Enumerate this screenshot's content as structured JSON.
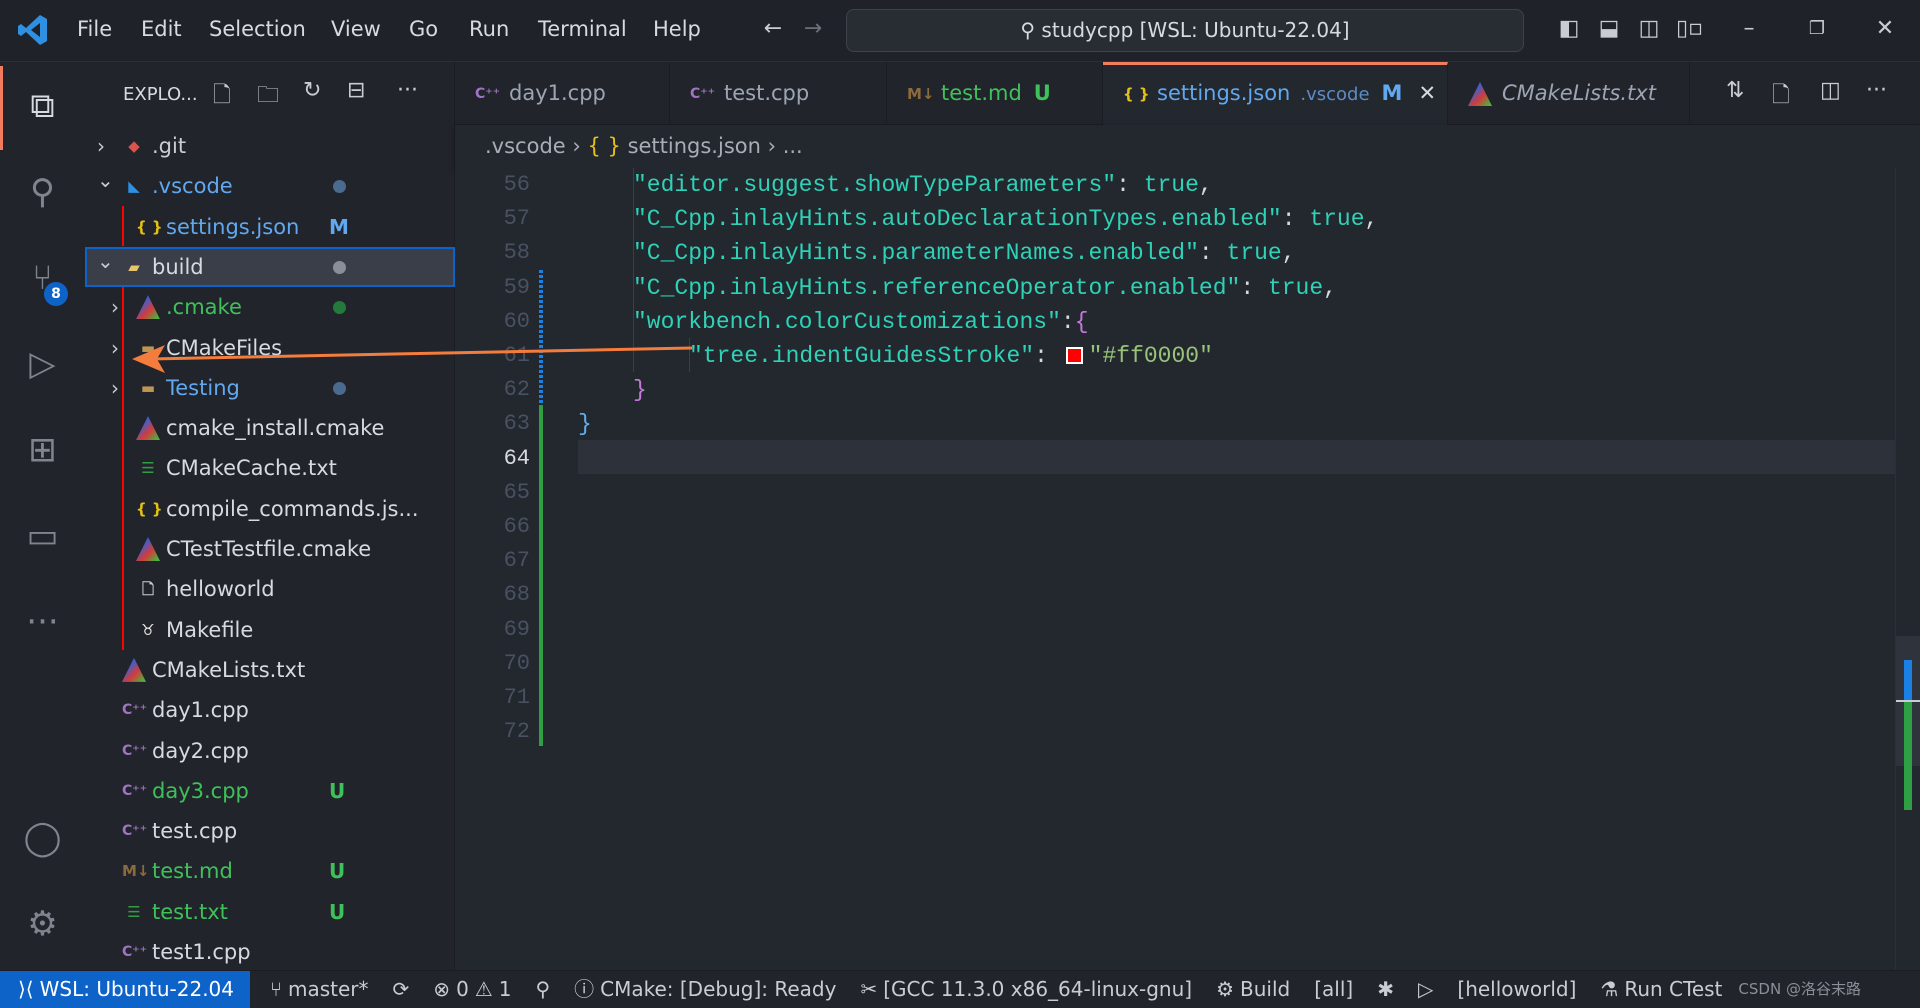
{
  "titlebar": {
    "menu": [
      "File",
      "Edit",
      "Selection",
      "View",
      "Go",
      "Run",
      "Terminal",
      "Help"
    ],
    "search": "studycpp [WSL: Ubuntu-22.04]"
  },
  "activity_bar": {
    "items": [
      {
        "icon": "explorer-icon",
        "active": true
      },
      {
        "icon": "search-icon"
      },
      {
        "icon": "source-control-icon",
        "badge": "8"
      },
      {
        "icon": "run-debug-icon"
      },
      {
        "icon": "extensions-icon"
      },
      {
        "icon": "remote-explorer-icon"
      },
      {
        "icon": "more-icon"
      }
    ],
    "bottom": [
      {
        "icon": "account-icon"
      },
      {
        "icon": "settings-gear-icon"
      }
    ]
  },
  "sidebar": {
    "title": "EXPLO...",
    "tree": [
      {
        "name": ".git",
        "depth": 0,
        "chevron": "closed",
        "icon": "git-folder",
        "color": "#c9ccd2"
      },
      {
        "name": ".vscode",
        "depth": 0,
        "chevron": "open",
        "icon": "vscode-folder",
        "color": "#61a8f0",
        "dot": "#4b6a8f"
      },
      {
        "name": "settings.json",
        "depth": 1,
        "icon": "json",
        "color": "#61a8f0",
        "badge": "M",
        "badge_color": "#61a8f0"
      },
      {
        "name": "build",
        "depth": 0,
        "chevron": "open",
        "icon": "build-folder",
        "color": "#d7dae0",
        "dot": "#8a8e96",
        "selected": true
      },
      {
        "name": ".cmake",
        "depth": 1,
        "chevron": "closed",
        "icon": "cmake-folder",
        "color": "#3fc15a",
        "dot": "#237a3a"
      },
      {
        "name": "CMakeFiles",
        "depth": 1,
        "chevron": "closed",
        "icon": "folder",
        "color": "#d7dae0"
      },
      {
        "name": "Testing",
        "depth": 1,
        "chevron": "closed",
        "icon": "folder",
        "color": "#61a8f0",
        "dot": "#4b6a8f"
      },
      {
        "name": "cmake_install.cmake",
        "depth": 1,
        "icon": "cmake",
        "color": "#d7dae0"
      },
      {
        "name": "CMakeCache.txt",
        "depth": 1,
        "icon": "text",
        "color": "#d7dae0"
      },
      {
        "name": "compile_commands.js...",
        "depth": 1,
        "icon": "json",
        "color": "#d7dae0"
      },
      {
        "name": "CTestTestfile.cmake",
        "depth": 1,
        "icon": "cmake",
        "color": "#d7dae0"
      },
      {
        "name": "helloworld",
        "depth": 1,
        "icon": "file",
        "color": "#d7dae0"
      },
      {
        "name": "Makefile",
        "depth": 1,
        "icon": "makefile",
        "color": "#d7dae0"
      },
      {
        "name": "CMakeLists.txt",
        "depth": 0,
        "icon": "cmake",
        "color": "#d7dae0"
      },
      {
        "name": "day1.cpp",
        "depth": 0,
        "icon": "cpp",
        "color": "#d7dae0"
      },
      {
        "name": "day2.cpp",
        "depth": 0,
        "icon": "cpp",
        "color": "#d7dae0"
      },
      {
        "name": "day3.cpp",
        "depth": 0,
        "icon": "cpp",
        "color": "#3fc15a",
        "badge": "U",
        "badge_color": "#3fc15a"
      },
      {
        "name": "test.cpp",
        "depth": 0,
        "icon": "cpp",
        "color": "#d7dae0"
      },
      {
        "name": "test.md",
        "depth": 0,
        "icon": "markdown",
        "color": "#3fc15a",
        "badge": "U",
        "badge_color": "#3fc15a"
      },
      {
        "name": "test.txt",
        "depth": 0,
        "icon": "text",
        "color": "#3fc15a",
        "badge": "U",
        "badge_color": "#3fc15a"
      },
      {
        "name": "test1.cpp",
        "depth": 0,
        "icon": "cpp",
        "color": "#d7dae0"
      }
    ]
  },
  "tabs": [
    {
      "name": "day1.cpp",
      "icon": "cpp",
      "color": "#9da5b4"
    },
    {
      "name": "test.cpp",
      "icon": "cpp",
      "color": "#9da5b4"
    },
    {
      "name": "test.md",
      "icon": "markdown",
      "color": "#3fc15a",
      "badge": "U"
    },
    {
      "name": "settings.json",
      "icon": "json",
      "color": "#61a8f0",
      "desc": ".vscode",
      "badge": "M",
      "active": true
    },
    {
      "name": "CMakeLists.txt",
      "icon": "cmake",
      "color": "#9da5b4",
      "italic": true
    }
  ],
  "breadcrumb": [
    ".vscode",
    "settings.json",
    "..."
  ],
  "editor": {
    "current_line": 64,
    "lines": [
      {
        "n": 56,
        "indent": 2,
        "tokens": [
          [
            "k",
            "\"editor.suggest.showTypeParameters\""
          ],
          [
            "p",
            ": "
          ],
          [
            "b",
            "true"
          ],
          [
            "p",
            ","
          ]
        ]
      },
      {
        "n": 57,
        "indent": 2,
        "tokens": [
          [
            "k",
            "\"C_Cpp.inlayHints.autoDeclarationTypes.enabled\""
          ],
          [
            "p",
            ": "
          ],
          [
            "b",
            "true"
          ],
          [
            "p",
            ","
          ]
        ]
      },
      {
        "n": 58,
        "indent": 2,
        "tokens": [
          [
            "k",
            "\"C_Cpp.inlayHints.parameterNames.enabled\""
          ],
          [
            "p",
            ": "
          ],
          [
            "b",
            "true"
          ],
          [
            "p",
            ","
          ]
        ]
      },
      {
        "n": 59,
        "indent": 2,
        "tokens": [
          [
            "k",
            "\"C_Cpp.inlayHints.referenceOperator.enabled\""
          ],
          [
            "p",
            ": "
          ],
          [
            "b",
            "true"
          ],
          [
            "p",
            ","
          ]
        ]
      },
      {
        "n": 60,
        "indent": 2,
        "tokens": [
          [
            "k",
            "\"workbench.colorCustomizations\""
          ],
          [
            "p",
            ":"
          ],
          [
            "br",
            "{"
          ]
        ]
      },
      {
        "n": 61,
        "indent": 3,
        "tokens": [
          [
            "k",
            "\"tree.indentGuidesStroke\""
          ],
          [
            "p",
            ": "
          ],
          [
            "swatch",
            "#ff0000"
          ],
          [
            "s",
            "\"#ff0000\""
          ]
        ]
      },
      {
        "n": 62,
        "indent": 2,
        "tokens": [
          [
            "br",
            "}"
          ]
        ]
      },
      {
        "n": 63,
        "indent": 1,
        "tokens": [
          [
            "br0",
            "}"
          ]
        ]
      },
      {
        "n": 64,
        "indent": 0,
        "tokens": []
      },
      {
        "n": 65,
        "indent": 0,
        "tokens": []
      },
      {
        "n": 66,
        "indent": 0,
        "tokens": []
      },
      {
        "n": 67,
        "indent": 0,
        "tokens": []
      },
      {
        "n": 68,
        "indent": 0,
        "tokens": []
      },
      {
        "n": 69,
        "indent": 0,
        "tokens": []
      },
      {
        "n": 70,
        "indent": 0,
        "tokens": []
      },
      {
        "n": 71,
        "indent": 0,
        "tokens": []
      },
      {
        "n": 72,
        "indent": 0,
        "tokens": []
      }
    ]
  },
  "statusbar": {
    "remote": "WSL: Ubuntu-22.04",
    "branch": "master*",
    "errors": "0",
    "warnings": "1",
    "cmake_status": "CMake: [Debug]: Ready",
    "kit": "[GCC 11.3.0 x86_64-linux-gnu]",
    "build": "Build",
    "target": "[all]",
    "launch_target": "[helloworld]",
    "ctest": "Run CTest",
    "watermark": "CSDN @洛谷末路"
  },
  "colors": {
    "accent": "#0e63c8",
    "tab_active_border": "#f47c5e",
    "annotation_arrow": "#f47c3c",
    "indent_guide": "#ff0000"
  }
}
